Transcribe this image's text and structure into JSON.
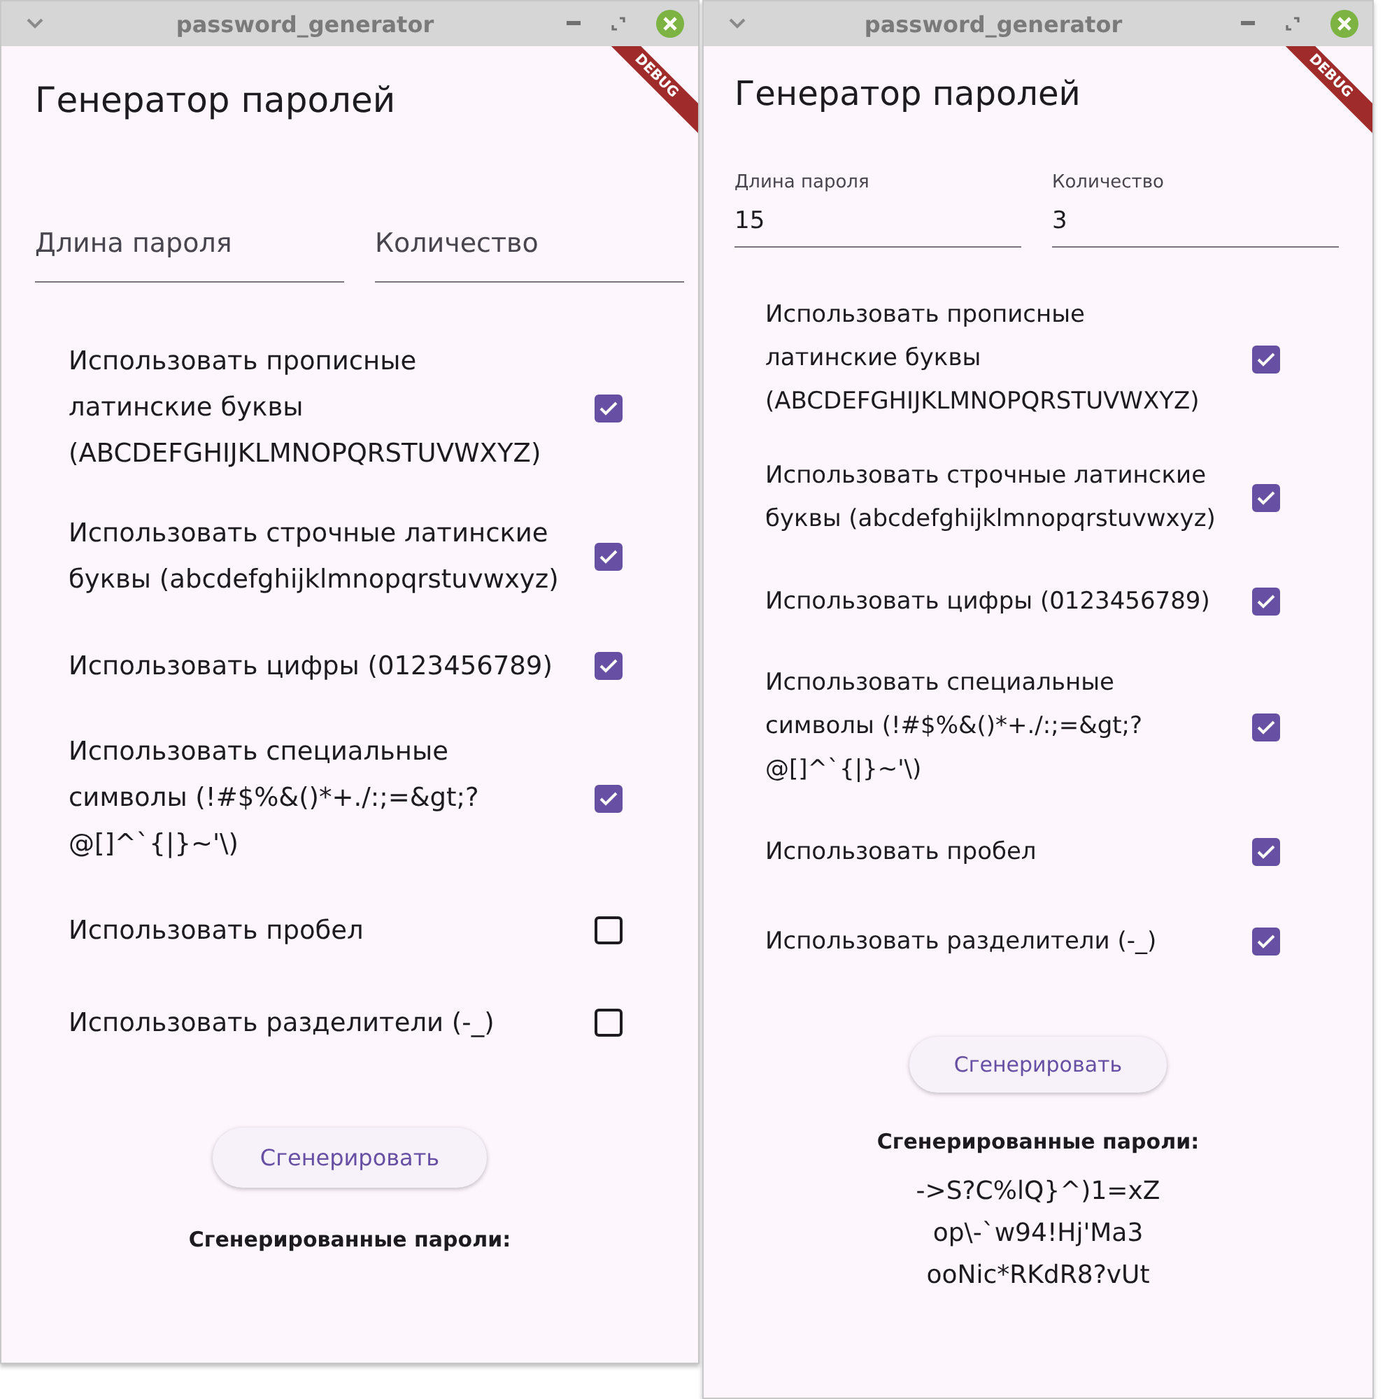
{
  "windows": [
    {
      "title": "password_generator",
      "app_title": "Генератор паролей",
      "debug_banner": "DEBUG",
      "fields": [
        {
          "label": "Длина пароля"
        },
        {
          "label": "Количество"
        }
      ],
      "options": [
        {
          "label": "Использовать прописные латинские буквы (ABCDEFGHIJKLMNOPQRSTUVWXYZ)",
          "checked": true
        },
        {
          "label": "Использовать строчные латинские буквы (abcdefghijklmnopqrstuvwxyz)",
          "checked": true
        },
        {
          "label": "Использовать цифры (0123456789)",
          "checked": true
        },
        {
          "label": "Использовать специальные символы (!#$%&()*+./:;=&gt;?@[]^`{|}~'\\)",
          "checked": true
        },
        {
          "label": "Использовать пробел",
          "checked": false
        },
        {
          "label": "Использовать разделители (-_)",
          "checked": false
        }
      ],
      "button": "Сгенерировать",
      "results_title": "Сгенерированные пароли:"
    },
    {
      "title": "password_generator",
      "app_title": "Генератор паролей",
      "debug_banner": "DEBUG",
      "fields": [
        {
          "label": "Длина пароля",
          "value": "15"
        },
        {
          "label": "Количество",
          "value": "3"
        }
      ],
      "options": [
        {
          "label": "Использовать прописные латинские буквы (ABCDEFGHIJKLMNOPQRSTUVWXYZ)",
          "checked": true
        },
        {
          "label": "Использовать строчные латинские буквы (abcdefghijklmnopqrstuvwxyz)",
          "checked": true
        },
        {
          "label": "Использовать цифры (0123456789)",
          "checked": true
        },
        {
          "label": "Использовать специальные символы (!#$%&()*+./:;=&gt;?@[]^`{|}~'\\)",
          "checked": true
        },
        {
          "label": "Использовать пробел",
          "checked": true
        },
        {
          "label": "Использовать разделители (-_)",
          "checked": true
        }
      ],
      "button": "Сгенерировать",
      "results_title": "Сгенерированные пароли:",
      "passwords": [
        "->S?C%lQ}^)1=xZ",
        "op\\-`w94!Hj'Ma3",
        "ooNic*RKdR8?vUt"
      ]
    }
  ]
}
